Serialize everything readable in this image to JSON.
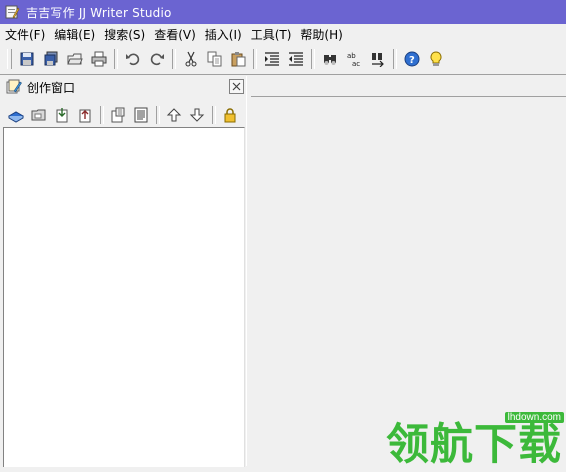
{
  "window": {
    "title": "吉吉写作 JJ Writer Studio"
  },
  "menu": [
    {
      "label": "文件(F)",
      "name": "menu-file"
    },
    {
      "label": "编辑(E)",
      "name": "menu-edit"
    },
    {
      "label": "搜索(S)",
      "name": "menu-search"
    },
    {
      "label": "查看(V)",
      "name": "menu-view"
    },
    {
      "label": "插入(I)",
      "name": "menu-insert"
    },
    {
      "label": "工具(T)",
      "name": "menu-tools"
    },
    {
      "label": "帮助(H)",
      "name": "menu-help"
    }
  ],
  "toolbar": {
    "groups": [
      [
        "save-icon",
        "save-all-icon",
        "open-icon",
        "print-icon"
      ],
      [
        "undo-icon",
        "redo-icon"
      ],
      [
        "cut-icon",
        "copy-icon",
        "paste-icon"
      ],
      [
        "indent-icon",
        "outdent-icon"
      ],
      [
        "find-icon",
        "replace-icon",
        "find-next-icon"
      ],
      [
        "help-icon",
        "tip-icon"
      ]
    ]
  },
  "panel": {
    "title": "创作窗口",
    "icon": "writing-window-icon",
    "toolbar": [
      [
        "book-icon",
        "new-folder-icon",
        "import-icon",
        "export-icon"
      ],
      [
        "properties-icon",
        "document-icon"
      ],
      [
        "move-up-icon",
        "move-down-icon"
      ],
      [
        "lock-icon"
      ]
    ]
  },
  "watermark": {
    "text": "领航下载",
    "url": "lhdown.com"
  },
  "colors": {
    "titlebar": "#6b64d1",
    "watermark": "#3cb93a"
  }
}
